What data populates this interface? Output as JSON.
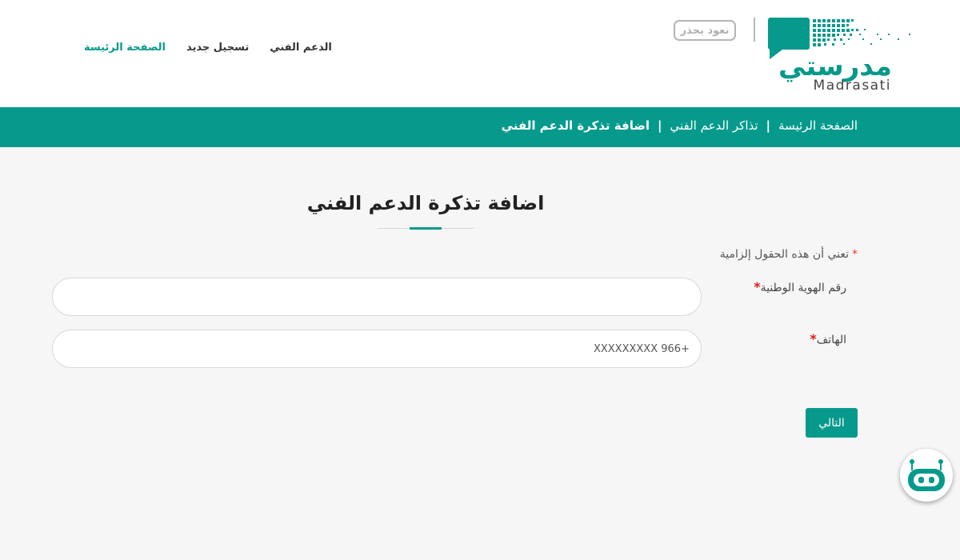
{
  "brand": {
    "logo_arabic": "مدرستي",
    "logo_latin": "Madrasati",
    "slogan": "نعود بحذر",
    "primary_color": "#069a8d",
    "logo_text_color": "#08998a"
  },
  "nav": {
    "items": [
      {
        "label": "الصفحة الرئيسة",
        "active": true
      },
      {
        "label": "تسجيل جديد",
        "active": false
      },
      {
        "label": "الدعم الفني",
        "active": false
      }
    ]
  },
  "breadcrumb": {
    "home": "الصفحة الرئيسة",
    "tickets": "تذاكر الدعم الفني",
    "current": "اضافة تذكرة الدعم الفني",
    "separator": "|"
  },
  "form": {
    "title": "اضافة تذكرة الدعم الفني",
    "required_note": "تعني أن هذه الحقول إلزامية",
    "required_star": "*",
    "fields": {
      "national_id": {
        "label": "رقم الهوية الوطنية",
        "value": "",
        "placeholder": ""
      },
      "phone": {
        "label": "الهاتف",
        "value": "",
        "placeholder": "+966 XXXXXXXXX"
      }
    },
    "next_label": "التالي"
  },
  "icons": {
    "logo": "madrasati-logo-icon",
    "chatbot": "robot-icon"
  },
  "chatbot": {
    "accent_color": "#069a8d"
  }
}
